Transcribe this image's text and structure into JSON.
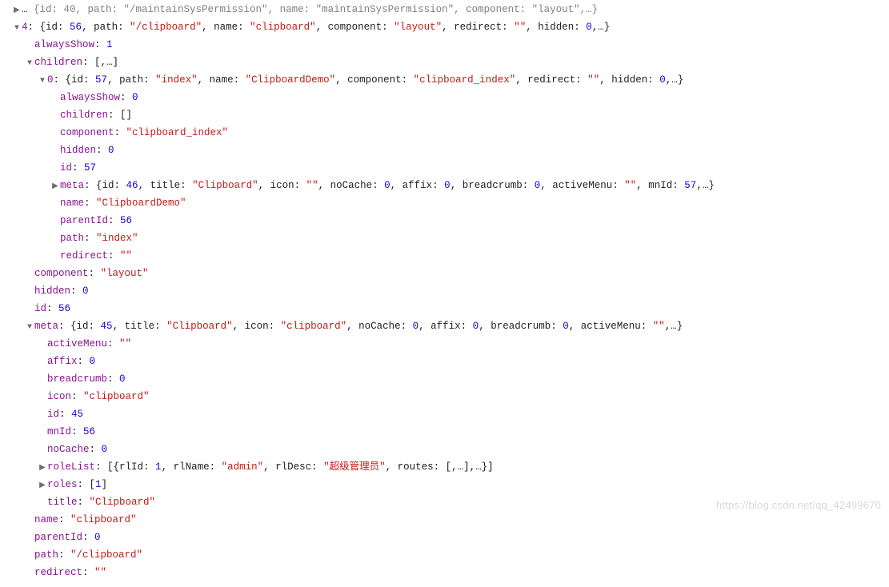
{
  "glyphs": {
    "right": "▶",
    "down": "▼"
  },
  "watermark": "https://blog.csdn.net/qq_42499670",
  "lines": [
    {
      "indent": 1,
      "arrow": "right",
      "dim": true,
      "tokens": [
        {
          "t": "punc",
          "v": "… "
        },
        {
          "t": "dim",
          "v": "{id: 40, path: \"/maintainSysPermission\", name: \"maintainSysPermission\", component: \"layout\",…}"
        }
      ]
    },
    {
      "indent": 1,
      "arrow": "down",
      "tokens": [
        {
          "t": "key",
          "v": "4"
        },
        {
          "t": "punc",
          "v": ": "
        },
        {
          "t": "punc",
          "v": "{id: "
        },
        {
          "t": "num",
          "v": "56"
        },
        {
          "t": "punc",
          "v": ", path: "
        },
        {
          "t": "str",
          "v": "\"/clipboard\""
        },
        {
          "t": "punc",
          "v": ", name: "
        },
        {
          "t": "str",
          "v": "\"clipboard\""
        },
        {
          "t": "punc",
          "v": ", component: "
        },
        {
          "t": "str",
          "v": "\"layout\""
        },
        {
          "t": "punc",
          "v": ", redirect: "
        },
        {
          "t": "str",
          "v": "\"\""
        },
        {
          "t": "punc",
          "v": ", hidden: "
        },
        {
          "t": "num",
          "v": "0"
        },
        {
          "t": "punc",
          "v": ",…}"
        }
      ]
    },
    {
      "indent": 2,
      "arrow": "none",
      "tokens": [
        {
          "t": "key",
          "v": "alwaysShow"
        },
        {
          "t": "punc",
          "v": ": "
        },
        {
          "t": "num",
          "v": "1"
        }
      ]
    },
    {
      "indent": 2,
      "arrow": "down",
      "tokens": [
        {
          "t": "key",
          "v": "children"
        },
        {
          "t": "punc",
          "v": ": ["
        },
        {
          "t": "punc",
          "v": ",…"
        },
        {
          "t": "punc",
          "v": "]"
        }
      ]
    },
    {
      "indent": 3,
      "arrow": "down",
      "tokens": [
        {
          "t": "key",
          "v": "0"
        },
        {
          "t": "punc",
          "v": ": "
        },
        {
          "t": "punc",
          "v": "{id: "
        },
        {
          "t": "num",
          "v": "57"
        },
        {
          "t": "punc",
          "v": ", path: "
        },
        {
          "t": "str",
          "v": "\"index\""
        },
        {
          "t": "punc",
          "v": ", name: "
        },
        {
          "t": "str",
          "v": "\"ClipboardDemo\""
        },
        {
          "t": "punc",
          "v": ", component: "
        },
        {
          "t": "str",
          "v": "\"clipboard_index\""
        },
        {
          "t": "punc",
          "v": ", redirect: "
        },
        {
          "t": "str",
          "v": "\"\""
        },
        {
          "t": "punc",
          "v": ", hidden: "
        },
        {
          "t": "num",
          "v": "0"
        },
        {
          "t": "punc",
          "v": ",…}"
        }
      ]
    },
    {
      "indent": 4,
      "arrow": "none",
      "tokens": [
        {
          "t": "key",
          "v": "alwaysShow"
        },
        {
          "t": "punc",
          "v": ": "
        },
        {
          "t": "num",
          "v": "0"
        }
      ]
    },
    {
      "indent": 4,
      "arrow": "none",
      "tokens": [
        {
          "t": "key",
          "v": "children"
        },
        {
          "t": "punc",
          "v": ": []"
        }
      ]
    },
    {
      "indent": 4,
      "arrow": "none",
      "tokens": [
        {
          "t": "key",
          "v": "component"
        },
        {
          "t": "punc",
          "v": ": "
        },
        {
          "t": "str",
          "v": "\"clipboard_index\""
        }
      ]
    },
    {
      "indent": 4,
      "arrow": "none",
      "tokens": [
        {
          "t": "key",
          "v": "hidden"
        },
        {
          "t": "punc",
          "v": ": "
        },
        {
          "t": "num",
          "v": "0"
        }
      ]
    },
    {
      "indent": 4,
      "arrow": "none",
      "tokens": [
        {
          "t": "key",
          "v": "id"
        },
        {
          "t": "punc",
          "v": ": "
        },
        {
          "t": "num",
          "v": "57"
        }
      ]
    },
    {
      "indent": 4,
      "arrow": "right",
      "tokens": [
        {
          "t": "key",
          "v": "meta"
        },
        {
          "t": "punc",
          "v": ": "
        },
        {
          "t": "punc",
          "v": "{id: "
        },
        {
          "t": "num",
          "v": "46"
        },
        {
          "t": "punc",
          "v": ", title: "
        },
        {
          "t": "str",
          "v": "\"Clipboard\""
        },
        {
          "t": "punc",
          "v": ", icon: "
        },
        {
          "t": "str",
          "v": "\"\""
        },
        {
          "t": "punc",
          "v": ", noCache: "
        },
        {
          "t": "num",
          "v": "0"
        },
        {
          "t": "punc",
          "v": ", affix: "
        },
        {
          "t": "num",
          "v": "0"
        },
        {
          "t": "punc",
          "v": ", breadcrumb: "
        },
        {
          "t": "num",
          "v": "0"
        },
        {
          "t": "punc",
          "v": ", activeMenu: "
        },
        {
          "t": "str",
          "v": "\"\""
        },
        {
          "t": "punc",
          "v": ", mnId: "
        },
        {
          "t": "num",
          "v": "57"
        },
        {
          "t": "punc",
          "v": ",…}"
        }
      ]
    },
    {
      "indent": 4,
      "arrow": "none",
      "tokens": [
        {
          "t": "key",
          "v": "name"
        },
        {
          "t": "punc",
          "v": ": "
        },
        {
          "t": "str",
          "v": "\"ClipboardDemo\""
        }
      ]
    },
    {
      "indent": 4,
      "arrow": "none",
      "tokens": [
        {
          "t": "key",
          "v": "parentId"
        },
        {
          "t": "punc",
          "v": ": "
        },
        {
          "t": "num",
          "v": "56"
        }
      ]
    },
    {
      "indent": 4,
      "arrow": "none",
      "tokens": [
        {
          "t": "key",
          "v": "path"
        },
        {
          "t": "punc",
          "v": ": "
        },
        {
          "t": "str",
          "v": "\"index\""
        }
      ]
    },
    {
      "indent": 4,
      "arrow": "none",
      "tokens": [
        {
          "t": "key",
          "v": "redirect"
        },
        {
          "t": "punc",
          "v": ": "
        },
        {
          "t": "str",
          "v": "\"\""
        }
      ]
    },
    {
      "indent": 2,
      "arrow": "none",
      "tokens": [
        {
          "t": "key",
          "v": "component"
        },
        {
          "t": "punc",
          "v": ": "
        },
        {
          "t": "str",
          "v": "\"layout\""
        }
      ]
    },
    {
      "indent": 2,
      "arrow": "none",
      "tokens": [
        {
          "t": "key",
          "v": "hidden"
        },
        {
          "t": "punc",
          "v": ": "
        },
        {
          "t": "num",
          "v": "0"
        }
      ]
    },
    {
      "indent": 2,
      "arrow": "none",
      "tokens": [
        {
          "t": "key",
          "v": "id"
        },
        {
          "t": "punc",
          "v": ": "
        },
        {
          "t": "num",
          "v": "56"
        }
      ]
    },
    {
      "indent": 2,
      "arrow": "down",
      "tokens": [
        {
          "t": "key",
          "v": "meta"
        },
        {
          "t": "punc",
          "v": ": "
        },
        {
          "t": "punc",
          "v": "{id: "
        },
        {
          "t": "num",
          "v": "45"
        },
        {
          "t": "punc",
          "v": ", title: "
        },
        {
          "t": "str",
          "v": "\"Clipboard\""
        },
        {
          "t": "punc",
          "v": ", icon: "
        },
        {
          "t": "str",
          "v": "\"clipboard\""
        },
        {
          "t": "punc",
          "v": ", noCache: "
        },
        {
          "t": "num",
          "v": "0"
        },
        {
          "t": "punc",
          "v": ", affix: "
        },
        {
          "t": "num",
          "v": "0"
        },
        {
          "t": "punc",
          "v": ", breadcrumb: "
        },
        {
          "t": "num",
          "v": "0"
        },
        {
          "t": "punc",
          "v": ", activeMenu: "
        },
        {
          "t": "str",
          "v": "\"\""
        },
        {
          "t": "punc",
          "v": ",…}"
        }
      ]
    },
    {
      "indent": 3,
      "arrow": "none",
      "tokens": [
        {
          "t": "key",
          "v": "activeMenu"
        },
        {
          "t": "punc",
          "v": ": "
        },
        {
          "t": "str",
          "v": "\"\""
        }
      ]
    },
    {
      "indent": 3,
      "arrow": "none",
      "tokens": [
        {
          "t": "key",
          "v": "affix"
        },
        {
          "t": "punc",
          "v": ": "
        },
        {
          "t": "num",
          "v": "0"
        }
      ]
    },
    {
      "indent": 3,
      "arrow": "none",
      "tokens": [
        {
          "t": "key",
          "v": "breadcrumb"
        },
        {
          "t": "punc",
          "v": ": "
        },
        {
          "t": "num",
          "v": "0"
        }
      ]
    },
    {
      "indent": 3,
      "arrow": "none",
      "tokens": [
        {
          "t": "key",
          "v": "icon"
        },
        {
          "t": "punc",
          "v": ": "
        },
        {
          "t": "str",
          "v": "\"clipboard\""
        }
      ]
    },
    {
      "indent": 3,
      "arrow": "none",
      "tokens": [
        {
          "t": "key",
          "v": "id"
        },
        {
          "t": "punc",
          "v": ": "
        },
        {
          "t": "num",
          "v": "45"
        }
      ]
    },
    {
      "indent": 3,
      "arrow": "none",
      "tokens": [
        {
          "t": "key",
          "v": "mnId"
        },
        {
          "t": "punc",
          "v": ": "
        },
        {
          "t": "num",
          "v": "56"
        }
      ]
    },
    {
      "indent": 3,
      "arrow": "none",
      "tokens": [
        {
          "t": "key",
          "v": "noCache"
        },
        {
          "t": "punc",
          "v": ": "
        },
        {
          "t": "num",
          "v": "0"
        }
      ]
    },
    {
      "indent": 3,
      "arrow": "right",
      "tokens": [
        {
          "t": "key",
          "v": "roleList"
        },
        {
          "t": "punc",
          "v": ": ["
        },
        {
          "t": "punc",
          "v": "{rlId: "
        },
        {
          "t": "num",
          "v": "1"
        },
        {
          "t": "punc",
          "v": ", rlName: "
        },
        {
          "t": "str",
          "v": "\"admin\""
        },
        {
          "t": "punc",
          "v": ", rlDesc: "
        },
        {
          "t": "str",
          "v": "\"超级管理员\""
        },
        {
          "t": "punc",
          "v": ", routes: [,…],…}"
        },
        {
          "t": "punc",
          "v": "]"
        }
      ]
    },
    {
      "indent": 3,
      "arrow": "right",
      "tokens": [
        {
          "t": "key",
          "v": "roles"
        },
        {
          "t": "punc",
          "v": ": ["
        },
        {
          "t": "num",
          "v": "1"
        },
        {
          "t": "punc",
          "v": "]"
        }
      ]
    },
    {
      "indent": 3,
      "arrow": "none",
      "tokens": [
        {
          "t": "key",
          "v": "title"
        },
        {
          "t": "punc",
          "v": ": "
        },
        {
          "t": "str",
          "v": "\"Clipboard\""
        }
      ]
    },
    {
      "indent": 2,
      "arrow": "none",
      "tokens": [
        {
          "t": "key",
          "v": "name"
        },
        {
          "t": "punc",
          "v": ": "
        },
        {
          "t": "str",
          "v": "\"clipboard\""
        }
      ]
    },
    {
      "indent": 2,
      "arrow": "none",
      "tokens": [
        {
          "t": "key",
          "v": "parentId"
        },
        {
          "t": "punc",
          "v": ": "
        },
        {
          "t": "num",
          "v": "0"
        }
      ]
    },
    {
      "indent": 2,
      "arrow": "none",
      "tokens": [
        {
          "t": "key",
          "v": "path"
        },
        {
          "t": "punc",
          "v": ": "
        },
        {
          "t": "str",
          "v": "\"/clipboard\""
        }
      ]
    },
    {
      "indent": 2,
      "arrow": "none",
      "tokens": [
        {
          "t": "key",
          "v": "redirect"
        },
        {
          "t": "punc",
          "v": ": "
        },
        {
          "t": "str",
          "v": "\"\""
        }
      ]
    }
  ]
}
